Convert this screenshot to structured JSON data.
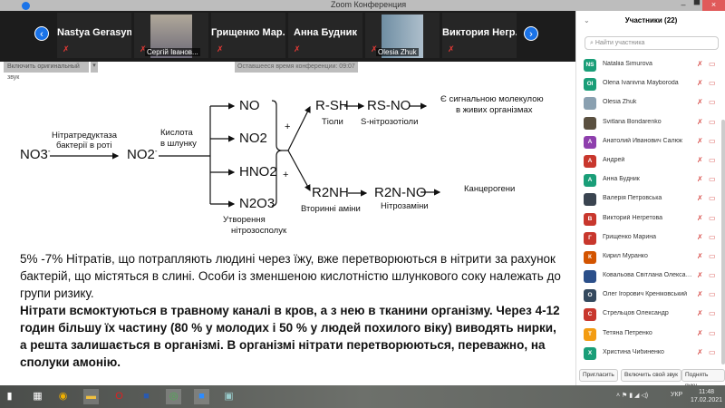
{
  "window": {
    "title": "Zoom Конференция",
    "minimize": "–",
    "restore": "▀",
    "close": "×"
  },
  "video_strip": {
    "tiles": [
      {
        "name": "Nastya  Gerasym..."
      },
      {
        "name": "",
        "label": "Сергій Іванов..."
      },
      {
        "name": "Грищенко  Мар..."
      },
      {
        "name": "Анна Будник"
      },
      {
        "name": "",
        "label": "Olesia Zhuk"
      },
      {
        "name": "Виктория  Негр..."
      }
    ],
    "prev": "‹",
    "next": "›"
  },
  "toolbar": {
    "original_sound": "Включить оригинальный звук",
    "dropdown": "▾",
    "time_left": "Оставшееся время конференции: 09:07"
  },
  "slide": {
    "nitrate": "NO3",
    "nitrate_charge": "-",
    "enzyme_line1": "Нітратредуктаза",
    "enzyme_line2": "бактерії в роті",
    "nitrite": "NO2",
    "nitrite_charge": "-",
    "acid_line1": "Кислота",
    "acid_line2": "в шлунку",
    "products": [
      "NO",
      "NO2",
      "HNO2",
      "N2O3"
    ],
    "products_label1": "Утворення",
    "products_label2": "нітрозосполук",
    "plus": "+",
    "thiol": "R-SH",
    "thiol_label": "Тіоли",
    "snitroso": "RS-NO",
    "snitroso_label": "S-нітрозотіоли",
    "signal_line1": "Є сигнальною молекулою",
    "signal_line2": "в живих організмах",
    "amine": "R2NH",
    "amine_label": "Вторинні аміни",
    "nitrosamine": "R2N-NO",
    "nitrosamine_label": "Нітрозаміни",
    "carcinogens": "Канцерогени",
    "paragraph1": "5% -7% Нітратів, що потрапляють людині через їжу, вже перетворюються в нітрити за рахунок бактерій, що містяться в слині. Особи із зменшеною кислотністю шлункового соку належать до групи ризику.",
    "paragraph2": "Нітрати всмоктуються в травному каналі в кров, а з нею в тканини організму. Через 4-12 годин більшу їх частину (80 % у молодих і 50 % у людей похилого віку) виводять нирки, а решта залишається в організмі. В організмі нітрати перетворюються, переважно, на сполуки амонію."
  },
  "participants": {
    "title": "Участники (22)",
    "collapse": "⌄",
    "search_placeholder": "Найти участника",
    "items": [
      {
        "initials": "NS",
        "name": "Nataliia Simurova",
        "color": "#1a9e78"
      },
      {
        "initials": "OI",
        "name": "Olena Ivanivna Mayboroda",
        "color": "#1a9e78"
      },
      {
        "initials": "",
        "name": "Olesia Zhuk",
        "color": "#8aa0b0"
      },
      {
        "initials": "",
        "name": "Svitlana Bondarenko",
        "color": "#5a5040"
      },
      {
        "initials": "А",
        "name": "Анатолий Иванович Салюк",
        "color": "#8e3fad"
      },
      {
        "initials": "А",
        "name": "Андрей",
        "color": "#c8372d"
      },
      {
        "initials": "А",
        "name": "Анна Будник",
        "color": "#1a9e78"
      },
      {
        "initials": "",
        "name": "Валерія Петровська",
        "color": "#3a4450"
      },
      {
        "initials": "В",
        "name": "Викторий Негретова",
        "color": "#c8372d"
      },
      {
        "initials": "Г",
        "name": "Грищенко Марина",
        "color": "#c8372d"
      },
      {
        "initials": "К",
        "name": "Кирил Муранко",
        "color": "#d35400"
      },
      {
        "initials": "",
        "name": "Ковальова Світлана Олександрівна",
        "color": "#2b4f8a"
      },
      {
        "initials": "О",
        "name": "Олег Ігорович Креніковський",
        "color": "#34495e"
      },
      {
        "initials": "С",
        "name": "Стрельцов Олександр",
        "color": "#c8372d"
      },
      {
        "initials": "Т",
        "name": "Тетяна Петренко",
        "color": "#f39c12"
      },
      {
        "initials": "Х",
        "name": "Христина Чибиненко",
        "color": "#1a9e78"
      }
    ],
    "invite": "Пригласить",
    "unmute_self": "Включить свой звук",
    "raise_hand": "Поднять руку"
  },
  "taskbar": {
    "lang": "УКР",
    "time": "11:48",
    "date": "17.02.2021"
  }
}
